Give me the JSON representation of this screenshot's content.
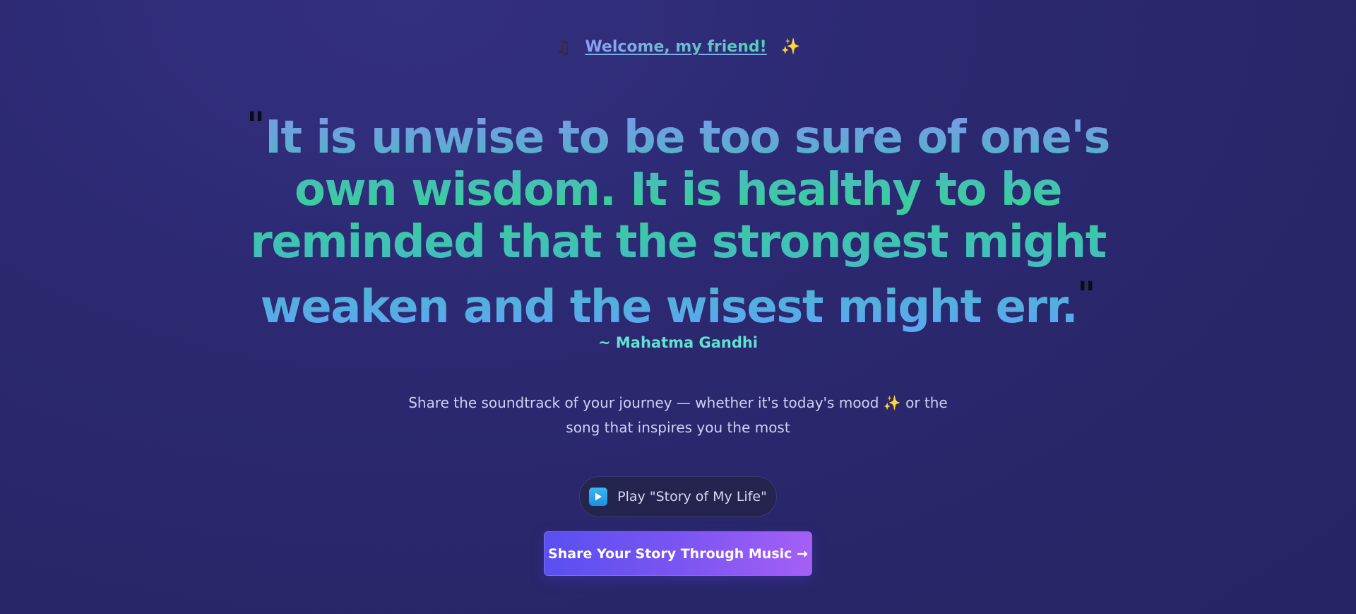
{
  "header": {
    "note_icon": "music-note-icon",
    "welcome_text": "Welcome, my friend!",
    "sparkle_icon": "sparkles-icon"
  },
  "quote": {
    "open_mark": "\"",
    "text": "It is unwise to be too sure of one's own wisdom. It is healthy to be reminded that the strongest might weaken and the wisest might err.",
    "close_mark": "\"",
    "author": "~ Mahatma Gandhi"
  },
  "description": {
    "text": "Share the soundtrack of your journey — whether it's today's mood ✨ or the song that inspires you the most"
  },
  "play_button": {
    "icon": "play-icon",
    "label": "Play \"Story of My Life\""
  },
  "cta_button": {
    "label": "Share Your Story Through Music →"
  },
  "colors": {
    "background": "#2b2870",
    "quote_gradient_start": "#8892ef",
    "quote_gradient_mid": "#38cf9a",
    "quote_gradient_end": "#5fa5f5",
    "author": "#5fe3cf",
    "cta_start": "#5a4ff0",
    "cta_end": "#a55ff5"
  }
}
